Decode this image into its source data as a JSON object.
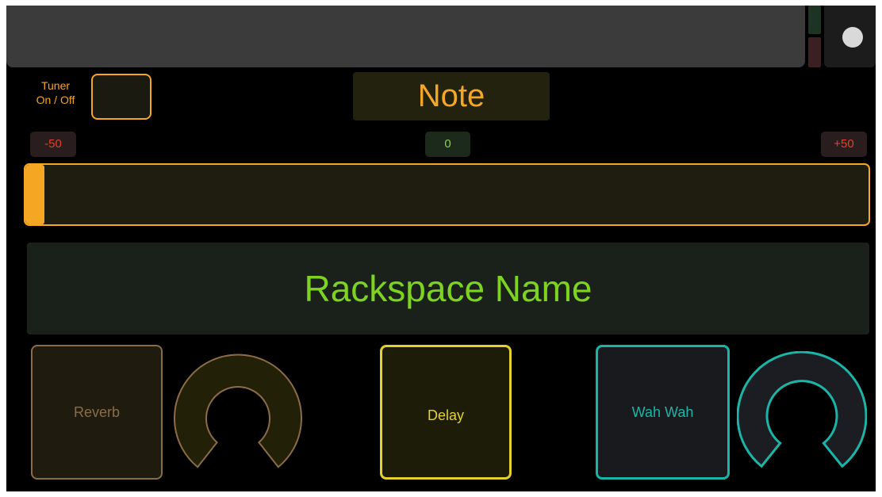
{
  "tuner": {
    "label_line1": "Tuner",
    "label_line2": "On / Off",
    "enabled": false,
    "note": "Note",
    "scale": {
      "min": "-50",
      "center": "0",
      "max": "+50"
    },
    "level_fraction": 0.0
  },
  "rackspace": {
    "name": "Rackspace Name"
  },
  "effects": {
    "reverb_label": "Reverb",
    "delay_label": "Delay",
    "wah_label": "Wah Wah"
  },
  "colors": {
    "accent": "#f5a623",
    "rackspace": "#7ed321",
    "reverb": "#8b6c47",
    "delay": "#e3d22e",
    "wah": "#1bb5a8",
    "meter_low": "#e0422e",
    "meter_center": "#8ad14a"
  },
  "icons": {
    "record": "record-dot-icon",
    "reverb_knob": "knob-icon",
    "wah_knob": "knob-icon"
  }
}
